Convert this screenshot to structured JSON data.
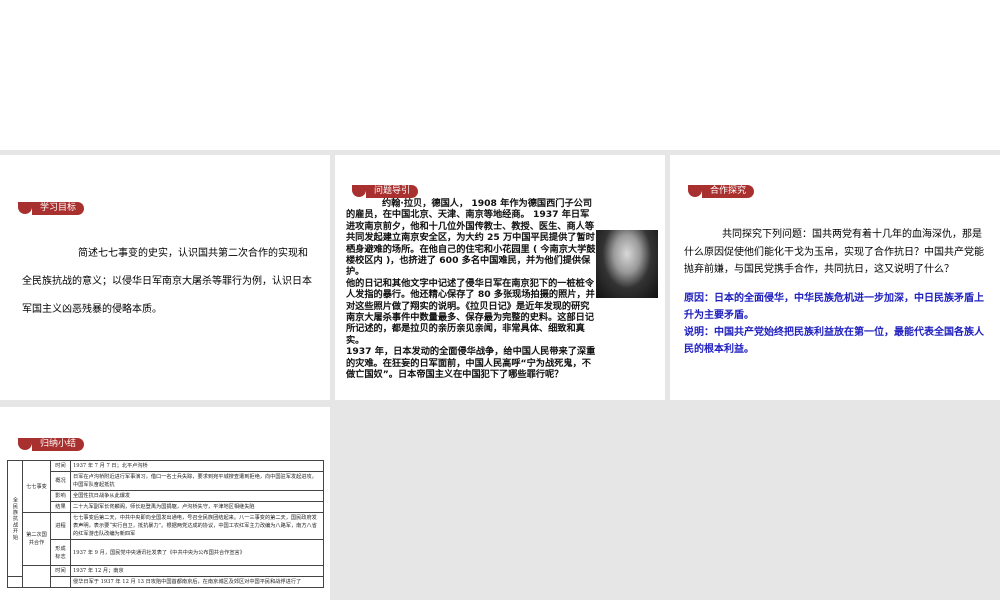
{
  "goals": {
    "tag": "学习目标",
    "text": "简述七七事变的史实，认识国共第二次合作的实现和全民族抗战的意义；以侵华日军南京大屠杀等罪行为例，认识日本军国主义凶恶残暴的侵略本质。"
  },
  "intro": {
    "tag": "问题导引",
    "paragraphs": [
      "约翰·拉贝，德国人， 1908 年作为德国西门子公司的雇员，在中国北京、天津、南京等地经商。 1937 年日军进攻南京前夕，他和十几位外国传教士、教授、医生、商人等共同发起建立南京安全区，为大约 25 万中国平民提供了暂时栖身避难的场所。在他自己的住宅和小花园里 ( 今南京大学鼓楼校区内 )，也挤进了 600 多名中国难民，并为他们提供保护。",
      "他的日记和其他文字中记述了侵华日军在南京犯下的一桩桩令人发指的暴行。他还精心保存了 80 多张现场拍摄的照片，并对这些照片做了翔实的说明。《拉贝日记》是近年发现的研究南京大屠杀事件中数量最多、保存最为完整的史料。这部日记所记述的，都是拉贝的亲历亲见亲闻，非常具体、细致和真实。",
      "1937 年，日本发动的全面侵华战争，给中国人民带来了深重的灾难。在狂妄的日军面前，中国人民高呼“宁为战死鬼，不做亡国奴”。日本帝国主义在中国犯下了哪些罪行呢？"
    ]
  },
  "coop": {
    "tag": "合作探究",
    "question": "共同探究下列问题：国共两党有着十几年的血海深仇，那是什么原因促使他们能化干戈为玉帛，实现了合作抗日？中国共产党能抛弃前嫌，与国民党携手合作，共同抗日，这又说明了什么？",
    "answer1": "原因：日本的全面侵华，中华民族危机进一步加深，中日民族矛盾上升为主要矛盾。",
    "answer2": "说明：中国共产党始终把民族利益放在第一位，最能代表全国各族人民的根本利益。"
  },
  "summary": {
    "tag": "归纳小结",
    "section": "全民族抗战开始",
    "groups": [
      "七七事变",
      "第二次国共合作"
    ],
    "rows": [
      {
        "k": "时间",
        "v": "1937 年 7 月 7 日；北平卢沟桥"
      },
      {
        "k": "概况",
        "v": "日军在卢沟桥附近进行军事演习，借口一名士兵失踪，要求到宛平城搜查遭到拒绝，向中国驻军发起进攻，中国军队奋起抵抗"
      },
      {
        "k": "影响",
        "v": "全国性抗日战争从此爆发"
      },
      {
        "k": "结果",
        "v": "二十九军副军长佟麟阁，师长赵登禹为国捐躯，卢沟桥失守，平津地区相继失陷"
      },
      {
        "k": "进程",
        "v": "七七事变后第二天，中共中央即向全国发出通电，号召全民族团结起来。八一三事变的第二天，国民政府发表声明，表示要“实行自卫，抵抗暴力”。根据两党达成的协议，中国工农红军主力改编为八路军，南方八省的红军游击队改编为新四军"
      },
      {
        "k": "形成标志",
        "v": "1937 年 9 月，国民党中央通讯社发表了《中共中央为公布国共合作宣言》"
      },
      {
        "k": "时间",
        "v": "1937 年 12 月；南京"
      },
      {
        "k": "",
        "v": "侵华日军于 1937 年 12 月 13 日攻陷中国首都南京后，在南京城区及郊区对中国平民和战俘进行了"
      }
    ]
  }
}
